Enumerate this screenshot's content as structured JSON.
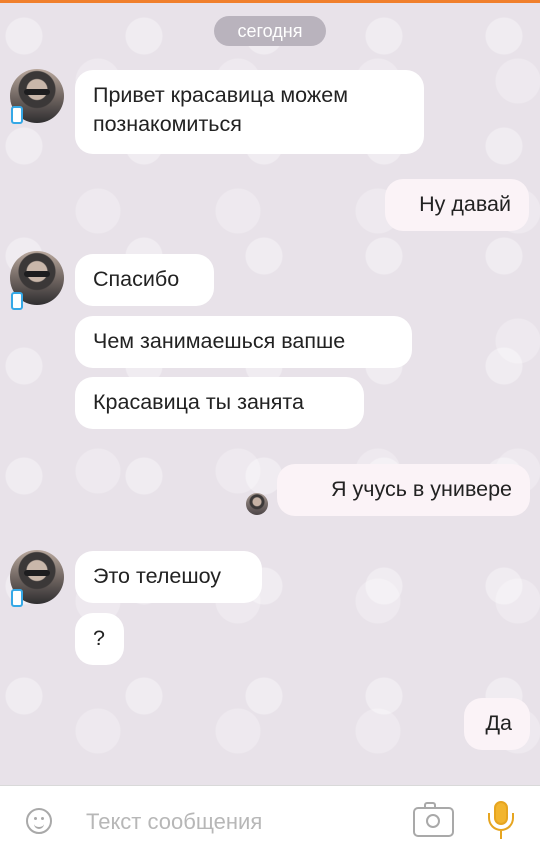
{
  "chat": {
    "date_label": "сегодня",
    "messages": [
      {
        "direction": "in",
        "lines": [
          "Привет красавица можем",
          "познакомиться"
        ]
      },
      {
        "direction": "out",
        "lines": [
          "Ну давай"
        ]
      },
      {
        "direction": "in",
        "lines": [
          "Спасибо"
        ]
      },
      {
        "direction": "in",
        "lines": [
          "Чем занимаешься вапше"
        ]
      },
      {
        "direction": "in",
        "lines": [
          "Красавица ты занята"
        ]
      },
      {
        "direction": "out",
        "lines": [
          "Я учусь в универе"
        ]
      },
      {
        "direction": "in",
        "lines": [
          "Это телешоу"
        ]
      },
      {
        "direction": "in",
        "lines": [
          "?"
        ]
      },
      {
        "direction": "out",
        "lines": [
          "Да"
        ]
      }
    ]
  },
  "composer": {
    "placeholder": "Текст сообщения",
    "value": ""
  },
  "icons": {
    "emoji": "emoji-icon",
    "camera": "camera-icon",
    "microphone": "microphone-icon",
    "device": "mobile-device-icon"
  },
  "colors": {
    "accent": "#f07f2c",
    "mic": "#f2b52f",
    "date_pill": "#b9b3bd",
    "chat_background": "#e8e2e9"
  }
}
